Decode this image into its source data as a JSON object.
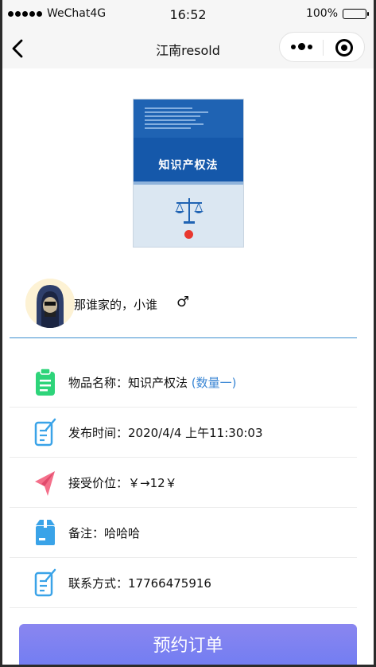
{
  "status_bar": {
    "carrier": "WeChat4G",
    "time": "16:52",
    "battery": "100%"
  },
  "nav": {
    "title": "江南resold"
  },
  "book": {
    "title": "知识产权法"
  },
  "seller": {
    "name": "那谁家的，小谁",
    "gender_symbol": "♂"
  },
  "details": {
    "item_name": {
      "label": "物品名称：知识产权法",
      "quantity": "(数量一)",
      "icon": "clipboard-icon",
      "color": "#2ed47a"
    },
    "publish_time": {
      "text": "发布时间：2020/4/4 上午11:30:03",
      "icon": "edit-note-icon",
      "color": "#3aa3e8"
    },
    "price": {
      "text": "接受价位：￥→12￥",
      "icon": "paper-plane-icon",
      "color": "#f46f8a"
    },
    "note": {
      "text": "备注：哈哈哈",
      "icon": "package-icon",
      "color": "#3aa3e8"
    },
    "contact": {
      "text": "联系方式：17766475916",
      "icon": "edit-note-icon",
      "color": "#3aa3e8"
    }
  },
  "action": {
    "order_label": "预约订单"
  }
}
